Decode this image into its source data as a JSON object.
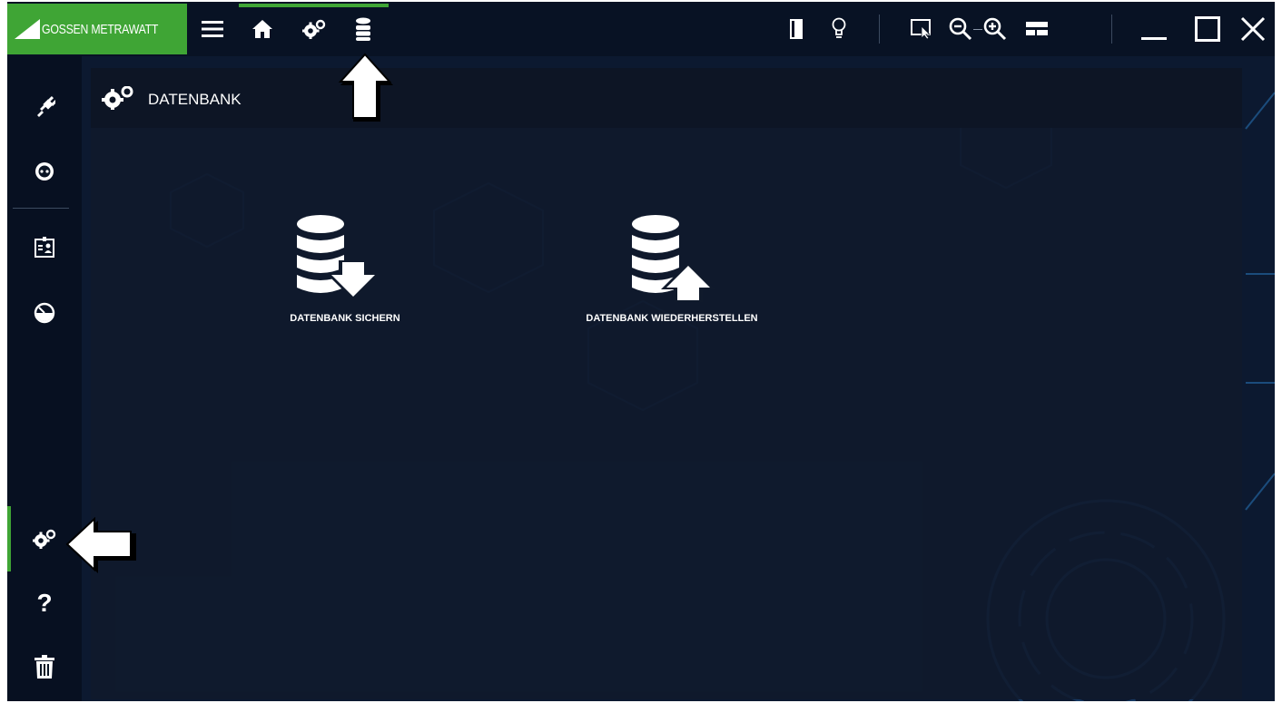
{
  "app": {
    "brand": "GOSSEN METRAWATT",
    "accent_color": "#3fa535",
    "background_color": "#0c1930"
  },
  "toolbar": {
    "left_icons": [
      "menu-icon",
      "home-icon",
      "settings-gears-icon",
      "database-icon"
    ],
    "active_tab": "database-icon",
    "right_icons": [
      "door-exit-icon",
      "lightbulb-icon",
      "cursor-select-icon",
      "zoom-out-icon",
      "zoom-in-icon",
      "layout-icon"
    ],
    "window_controls": [
      "minimize-icon",
      "maximize-icon",
      "close-icon"
    ]
  },
  "sidebar": {
    "items": [
      {
        "icon": "plug-icon"
      },
      {
        "icon": "socket-icon"
      },
      {
        "icon": "id-badge-icon"
      },
      {
        "icon": "gauge-icon"
      },
      {
        "icon": "settings-gears-icon",
        "active": true
      },
      {
        "icon": "help-icon",
        "glyph": "?"
      },
      {
        "icon": "trash-icon"
      }
    ]
  },
  "panel": {
    "title": "DATENBANK",
    "actions": [
      {
        "label": "DATENBANK SICHERN",
        "icon": "database-download-icon"
      },
      {
        "label": "DATENBANK WIEDERHERSTELLEN",
        "icon": "database-upload-icon"
      }
    ]
  }
}
